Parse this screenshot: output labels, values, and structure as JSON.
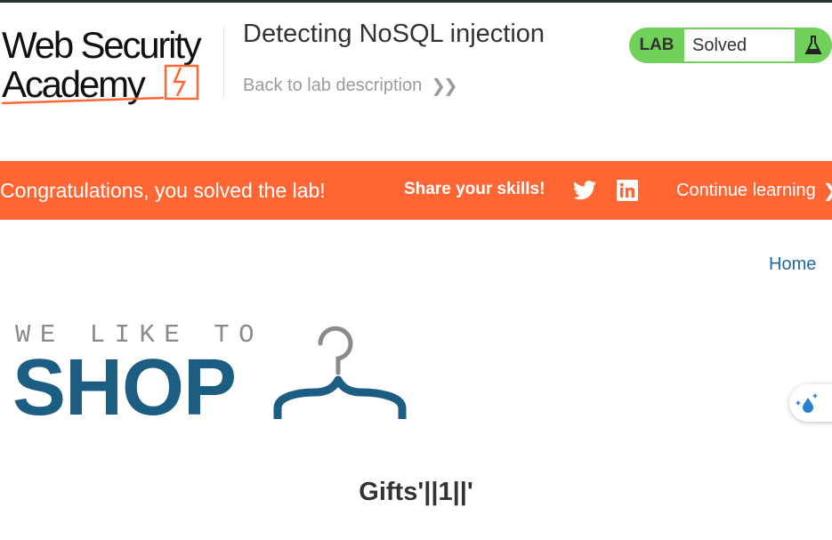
{
  "header": {
    "logo_line1": "Web Security",
    "logo_line2": "Academy",
    "lab_title": "Detecting NoSQL injection",
    "back_link": "Back to lab description",
    "lab_label": "LAB",
    "lab_status": "Solved"
  },
  "banner": {
    "message": "Congratulations, you solved the lab!",
    "share_label": "Share your skills!",
    "continue_label": "Continue learning",
    "background_color": "#ff6633"
  },
  "nav": {
    "home_label": "Home"
  },
  "shop_logo": {
    "tagline": "WE LIKE TO",
    "word": "SHOP"
  },
  "main": {
    "heading": "Gifts'||1||'"
  },
  "colors": {
    "lab_green": "#70d15a",
    "link_blue": "#1a6aa8",
    "shop_blue": "#1c5d84"
  },
  "icons": {
    "lab_icon": "flask-icon",
    "share_icons": [
      "twitter-icon",
      "linkedin-icon"
    ],
    "widget_icon": "sparkle-drop-icon"
  }
}
